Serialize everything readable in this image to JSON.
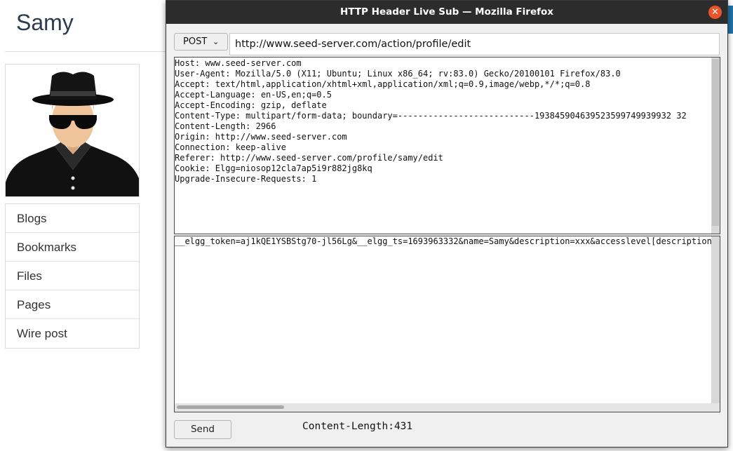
{
  "background_page": {
    "site_title": "Samy",
    "sidebar_items": [
      {
        "label": "Blogs"
      },
      {
        "label": "Bookmarks"
      },
      {
        "label": "Files"
      },
      {
        "label": "Pages"
      },
      {
        "label": "Wire post"
      }
    ]
  },
  "window": {
    "title": "HTTP Header Live Sub — Mozilla Firefox",
    "close_icon": "close-icon"
  },
  "request": {
    "method": "POST",
    "method_icon": "chevron-down-icon",
    "url": "http://www.seed-server.com/action/profile/edit",
    "headers_text": "Host: www.seed-server.com\nUser-Agent: Mozilla/5.0 (X11; Ubuntu; Linux x86_64; rv:83.0) Gecko/20100101 Firefox/83.0\nAccept: text/html,application/xhtml+xml,application/xml;q=0.9,image/webp,*/*;q=0.8\nAccept-Language: en-US,en;q=0.5\nAccept-Encoding: gzip, deflate\nContent-Type: multipart/form-data; boundary=---------------------------193845904639523599749939932 32\nContent-Length: 2966\nOrigin: http://www.seed-server.com\nConnection: keep-alive\nReferer: http://www.seed-server.com/profile/samy/edit\nCookie: Elgg=niosop12cla7ap5i9r882jg8kq\nUpgrade-Insecure-Requests: 1",
    "body_text": "__elgg_token=aj1kQE1YSBStg70-jl56Lg&__elgg_ts=1693963332&name=Samy&description=xxx&accesslevel[description",
    "send_label": "Send",
    "content_length_text": "Content-Length:431"
  }
}
